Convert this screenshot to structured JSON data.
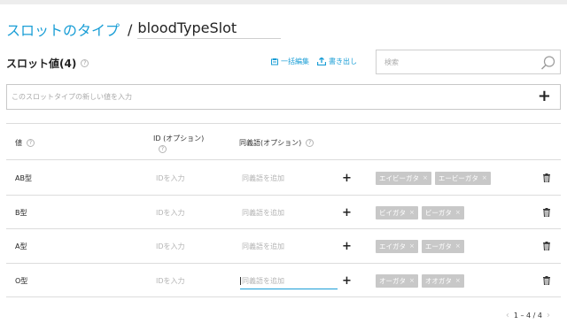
{
  "header": {
    "title": "スロットのタイプ",
    "separator": "/",
    "slot_type_name": "bloodTypeSlot"
  },
  "values_section": {
    "label": "スロット値(4)",
    "help": "?"
  },
  "actions": {
    "bulk_edit": "一括編集",
    "export": "書き出し"
  },
  "search": {
    "placeholder": "検索"
  },
  "add_value": {
    "placeholder": "このスロットタイプの新しい値を入力",
    "add_symbol": "+"
  },
  "columns": {
    "value": "値",
    "id": "ID (オプション)",
    "synonyms": "同義語(オプション)",
    "help": "?"
  },
  "rows": [
    {
      "value": "AB型",
      "id_placeholder": "IDを入力",
      "synonym_placeholder": "同義語を追加",
      "add": "+",
      "synonyms": [
        "エイビーガタ",
        "エービーガタ"
      ]
    },
    {
      "value": "B型",
      "id_placeholder": "IDを入力",
      "synonym_placeholder": "同義語を追加",
      "add": "+",
      "synonyms": [
        "ビイガタ",
        "ビーガタ"
      ]
    },
    {
      "value": "A型",
      "id_placeholder": "IDを入力",
      "synonym_placeholder": "同義語を追加",
      "add": "+",
      "synonyms": [
        "エイガタ",
        "エーガタ"
      ]
    },
    {
      "value": "O型",
      "id_placeholder": "IDを入力",
      "synonym_placeholder": "同義語を追加",
      "add": "+",
      "synonyms": [
        "オーガタ",
        "オオガタ"
      ]
    }
  ],
  "chip_remove": "×",
  "pagination": {
    "prev": "‹",
    "range": "1 – 4 / 4",
    "next": "›"
  },
  "colors": {
    "accent": "#1a9ed6",
    "chip": "#c8c8c8"
  }
}
